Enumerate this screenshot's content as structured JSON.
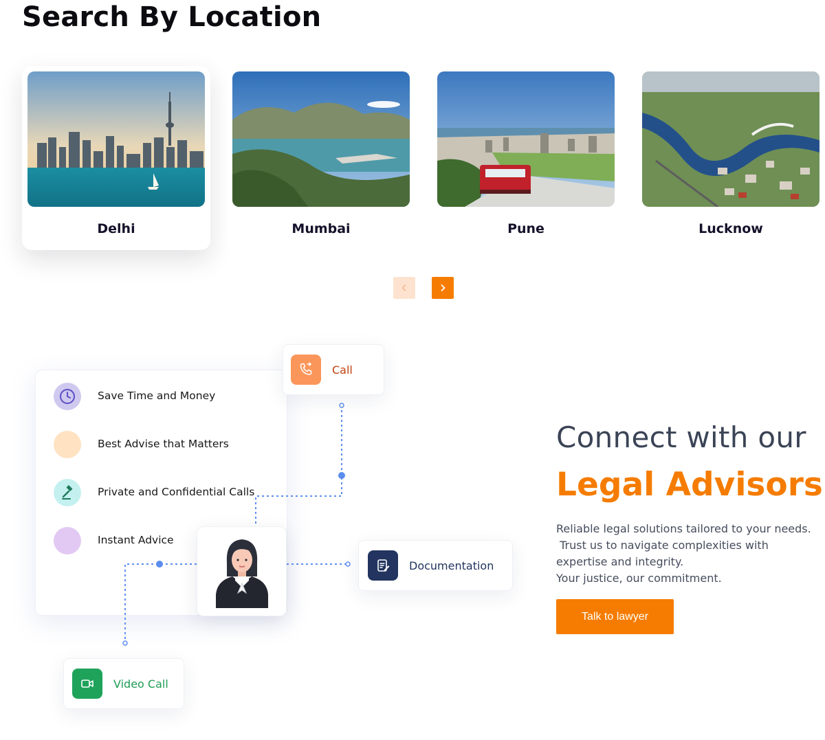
{
  "section_title": "Search By Location",
  "locations": [
    {
      "city": "Delhi"
    },
    {
      "city": "Mumbai"
    },
    {
      "city": "Pune"
    },
    {
      "city": "Lucknow"
    }
  ],
  "carousel": {
    "prev_icon": "chevron-left-icon",
    "next_icon": "chevron-right-icon"
  },
  "features": [
    {
      "label": "Save Time and Money",
      "icon": "clock-icon",
      "bg": "#cfc9f0"
    },
    {
      "label": "Best Advise that Matters",
      "icon": "dot-icon",
      "bg": "#ffe2c2"
    },
    {
      "label": "Private and Confidential Calls",
      "icon": "gavel-icon",
      "bg": "#c4f1f0"
    },
    {
      "label": "Instant Advice",
      "icon": "dot-icon",
      "bg": "#e2c9f3"
    }
  ],
  "services": {
    "call": {
      "label": "Call",
      "icon": "phone-icon",
      "color": "#c2410c",
      "icon_bg": "#fb965a"
    },
    "documentation": {
      "label": "Documentation",
      "icon": "document-edit-icon",
      "color": "#22345f",
      "icon_bg": "#22345f"
    },
    "video_call": {
      "label": "Video Call",
      "icon": "video-icon",
      "color": "#1f9d55",
      "icon_bg": "#1fa35b"
    }
  },
  "advisor_avatar": "lawyer-avatar",
  "connect": {
    "title": "Connect with our",
    "highlight": "Legal Advisors",
    "description_lines": [
      "Reliable legal solutions tailored to your needs.",
      " Trust us to navigate complexities with",
      "expertise and integrity.",
      "Your justice, our commitment."
    ],
    "cta_label": "Talk to lawyer"
  },
  "colors": {
    "accent": "#f57c00",
    "heading": "#3b4456",
    "connector": "#5b8def"
  }
}
